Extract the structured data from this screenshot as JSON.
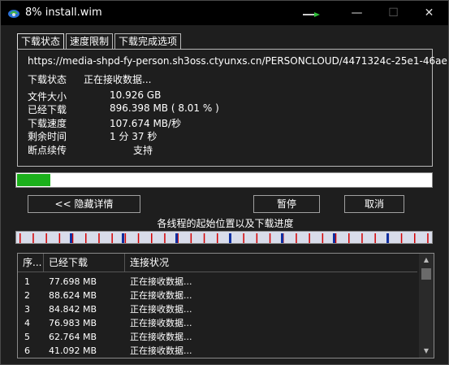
{
  "window": {
    "title": "8% install.wim",
    "min": "—",
    "max": "☐",
    "close": "✕"
  },
  "tabs": [
    "下载状态",
    "速度限制",
    "下载完成选项"
  ],
  "status": {
    "url": "https://media-shpd-fy-person.sh3oss.ctyunxs.cn/PERSONCLOUD/4471324c-25e1-46ae",
    "state_label": "下载状态",
    "state_value": "正在接收数据...",
    "size_label": "文件大小",
    "size_value": "10.926  GB",
    "downloaded_label": "已经下载",
    "downloaded_value": "896.398  MB ( 8.01 % )",
    "speed_label": "下载速度",
    "speed_value": "107.674  MB/秒",
    "remaining_label": "剩余时间",
    "remaining_value": "1 分 37 秒",
    "resume_label": "断点续传",
    "resume_value": "支持"
  },
  "progress": 0.0801,
  "buttons": {
    "hide_details": "<< 隐藏详情",
    "pause": "暂停",
    "cancel": "取消"
  },
  "threads_caption": "各线程的起始位置以及下载进度",
  "list": {
    "headers": [
      "序...",
      "已经下载",
      "连接状况"
    ],
    "rows": [
      {
        "n": "1",
        "dl": "77.698  MB",
        "state": "正在接收数据..."
      },
      {
        "n": "2",
        "dl": "88.624  MB",
        "state": "正在接收数据..."
      },
      {
        "n": "3",
        "dl": "84.842  MB",
        "state": "正在接收数据..."
      },
      {
        "n": "4",
        "dl": "76.983  MB",
        "state": "正在接收数据..."
      },
      {
        "n": "5",
        "dl": "62.764  MB",
        "state": "正在接收数据..."
      },
      {
        "n": "6",
        "dl": "41.092  MB",
        "state": "正在接收数据..."
      }
    ]
  },
  "colors": {
    "progress": "#1cb01c",
    "thread_mark_red": "#d40000",
    "thread_mark_blue": "#1030a0",
    "strip_bg": "#d8dcea"
  }
}
